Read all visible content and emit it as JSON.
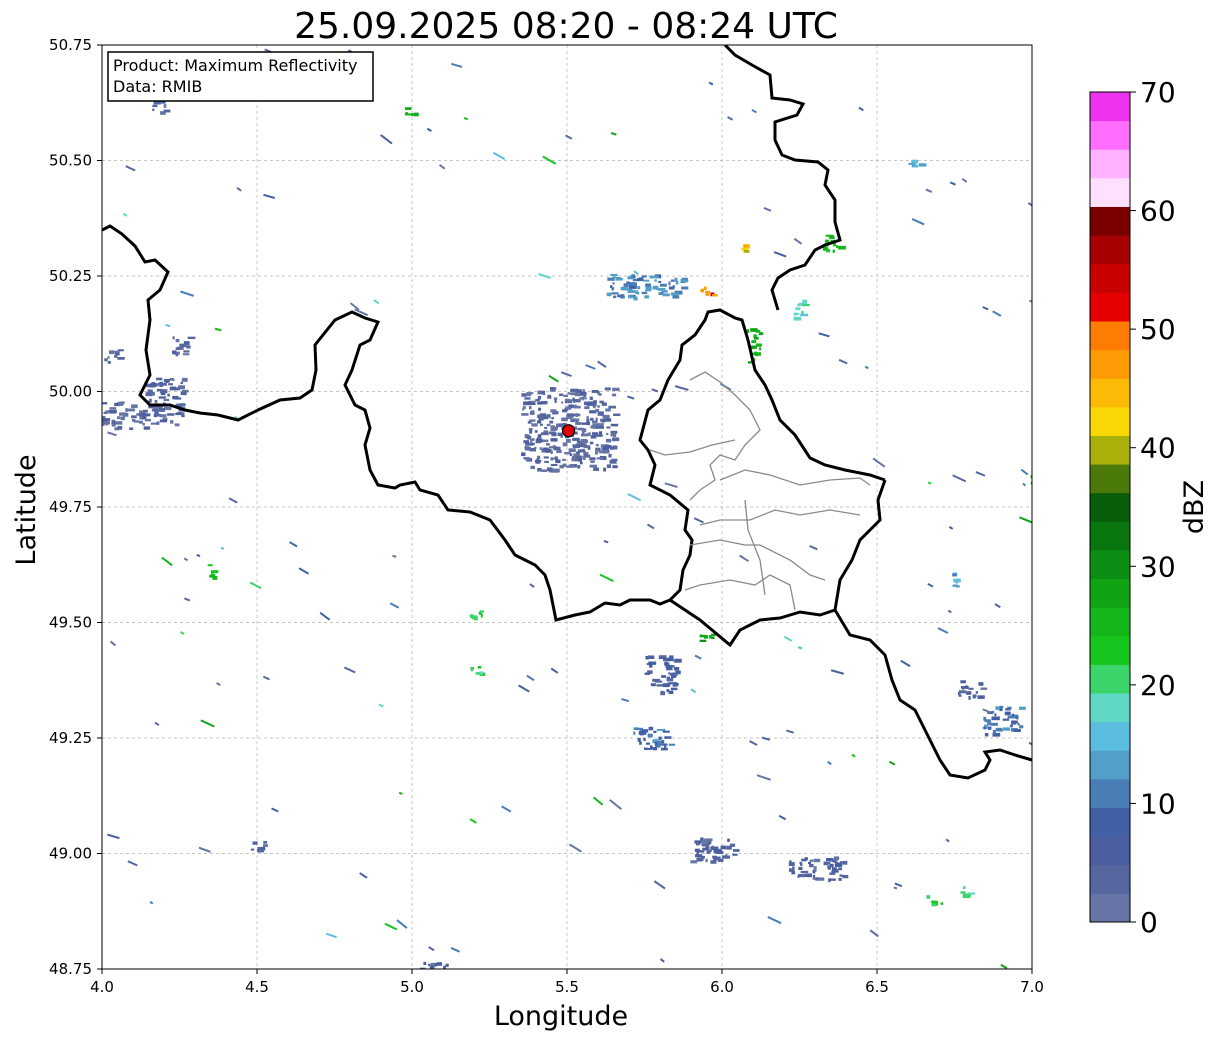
{
  "title": "25.09.2025 08:20 - 08:24 UTC",
  "info_box": {
    "line1": "Product: Maximum Reflectivity",
    "line2": "Data: RMIB"
  },
  "chart_data": {
    "type": "heatmap",
    "title": "25.09.2025 08:20 - 08:24 UTC",
    "xlabel": "Longitude",
    "ylabel": "Latitude",
    "xlim": [
      4.0,
      7.0
    ],
    "ylim": [
      48.75,
      50.75
    ],
    "grid": true,
    "x_ticks": [
      "4.0",
      "4.5",
      "5.0",
      "5.5",
      "6.0",
      "6.5",
      "7.0"
    ],
    "y_ticks": [
      "50.75",
      "50.50",
      "50.25",
      "50.00",
      "49.75",
      "49.50",
      "49.25",
      "49.00",
      "48.75"
    ],
    "radar_site": {
      "lon": 5.505,
      "lat": 49.915,
      "color": "#e00000"
    },
    "colorbar": {
      "label": "dBZ",
      "min": 0,
      "max": 70,
      "step": 2.5,
      "ticks": [
        "0",
        "10",
        "20",
        "30",
        "40",
        "50",
        "60",
        "70"
      ],
      "colors": [
        "#6675a5",
        "#5667a0",
        "#4b5fa0",
        "#4260a5",
        "#4a7db6",
        "#52a0c8",
        "#5cbede",
        "#5fd8c6",
        "#3bd46a",
        "#17c61e",
        "#14b61a",
        "#10a415",
        "#0c8e14",
        "#0a7610",
        "#085d0b",
        "#4b7a0a",
        "#aab00a",
        "#fad805",
        "#fbba05",
        "#fc9b04",
        "#fd7c04",
        "#e40000",
        "#c80000",
        "#a60000",
        "#7a0000",
        "#ffe0ff",
        "#ffb2ff",
        "#ff6eff",
        "#ee33ee"
      ]
    },
    "echo_regions": [
      {
        "lon": 4.05,
        "lat": 49.95,
        "dbz": 3,
        "w": 0.18,
        "h": 0.06
      },
      {
        "lon": 4.2,
        "lat": 49.98,
        "dbz": 4,
        "w": 0.12,
        "h": 0.1
      },
      {
        "lon": 4.25,
        "lat": 50.1,
        "dbz": 3,
        "w": 0.06,
        "h": 0.04
      },
      {
        "lon": 4.03,
        "lat": 50.08,
        "dbz": 3,
        "w": 0.05,
        "h": 0.03
      },
      {
        "lon": 4.18,
        "lat": 50.62,
        "dbz": 4,
        "w": 0.05,
        "h": 0.03
      },
      {
        "lon": 5.8,
        "lat": 49.39,
        "dbz": 6,
        "w": 0.1,
        "h": 0.08
      },
      {
        "lon": 5.77,
        "lat": 49.25,
        "dbz": 10,
        "w": 0.12,
        "h": 0.05
      },
      {
        "lon": 5.97,
        "lat": 49.01,
        "dbz": 5,
        "w": 0.15,
        "h": 0.05
      },
      {
        "lon": 6.3,
        "lat": 48.97,
        "dbz": 5,
        "w": 0.18,
        "h": 0.05
      },
      {
        "lon": 6.9,
        "lat": 49.29,
        "dbz": 10,
        "w": 0.12,
        "h": 0.06
      },
      {
        "lon": 6.8,
        "lat": 49.36,
        "dbz": 5,
        "w": 0.08,
        "h": 0.04
      },
      {
        "lon": 4.5,
        "lat": 49.02,
        "dbz": 5,
        "w": 0.05,
        "h": 0.02
      },
      {
        "lon": 5.05,
        "lat": 48.76,
        "dbz": 5,
        "w": 0.12,
        "h": 0.02
      },
      {
        "lon": 5.75,
        "lat": 50.23,
        "dbz": 12,
        "w": 0.25,
        "h": 0.05
      },
      {
        "lon": 5.5,
        "lat": 49.92,
        "dbz": 3,
        "w": 0.3,
        "h": 0.18
      },
      {
        "lon": 5.95,
        "lat": 50.22,
        "dbz": 50,
        "w": 0.04,
        "h": 0.02
      },
      {
        "lon": 6.07,
        "lat": 50.31,
        "dbz": 45,
        "w": 0.04,
        "h": 0.02
      },
      {
        "lon": 6.35,
        "lat": 50.32,
        "dbz": 25,
        "w": 0.06,
        "h": 0.04
      },
      {
        "lon": 6.1,
        "lat": 50.1,
        "dbz": 27,
        "w": 0.04,
        "h": 0.08
      },
      {
        "lon": 6.25,
        "lat": 50.18,
        "dbz": 20,
        "w": 0.05,
        "h": 0.04
      },
      {
        "lon": 5.2,
        "lat": 49.52,
        "dbz": 22,
        "w": 0.05,
        "h": 0.02
      },
      {
        "lon": 4.35,
        "lat": 49.62,
        "dbz": 25,
        "w": 0.02,
        "h": 0.04
      },
      {
        "lon": 5.95,
        "lat": 49.47,
        "dbz": 28,
        "w": 0.06,
        "h": 0.02
      },
      {
        "lon": 6.68,
        "lat": 48.9,
        "dbz": 22,
        "w": 0.05,
        "h": 0.02
      },
      {
        "lon": 6.78,
        "lat": 48.92,
        "dbz": 20,
        "w": 0.04,
        "h": 0.02
      },
      {
        "lon": 7.0,
        "lat": 49.8,
        "dbz": 22,
        "w": 0.02,
        "h": 0.04
      },
      {
        "lon": 4.99,
        "lat": 50.61,
        "dbz": 28,
        "w": 0.04,
        "h": 0.02
      },
      {
        "lon": 5.2,
        "lat": 49.4,
        "dbz": 22,
        "w": 0.04,
        "h": 0.02
      },
      {
        "lon": 6.75,
        "lat": 49.6,
        "dbz": 15,
        "w": 0.02,
        "h": 0.04
      },
      {
        "lon": 6.62,
        "lat": 50.5,
        "dbz": 15,
        "w": 0.04,
        "h": 0.02
      }
    ]
  }
}
